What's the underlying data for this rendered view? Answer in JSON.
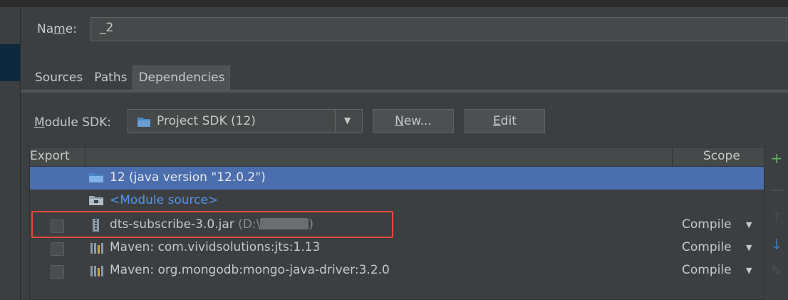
{
  "name_field": {
    "label_prefix": "Na",
    "label_underlined": "m",
    "label_suffix": "e:",
    "value": "_2"
  },
  "tabs": [
    {
      "label": "Sources",
      "active": false
    },
    {
      "label": "Paths",
      "active": false
    },
    {
      "label": "Dependencies",
      "active": true
    }
  ],
  "module_sdk": {
    "label_underlined": "M",
    "label_rest": "odule SDK:",
    "selected": "Project SDK (12)",
    "new_button_underlined": "N",
    "new_button_rest": "ew...",
    "edit_button_underlined": "E",
    "edit_button_rest": "dit"
  },
  "table": {
    "header_export": "Export",
    "header_scope": "Scope",
    "rows": [
      {
        "icon": "jdk-folder-icon",
        "text": "12 (java version \"12.0.2\")",
        "scope": "",
        "selected": true
      },
      {
        "icon": "module-source-folder-icon",
        "text": "<Module source>",
        "scope": "",
        "selected": false
      },
      {
        "icon": "jar-archive-icon",
        "text": "dts-subscribe-3.0.jar",
        "path_prefix": "(D:\\",
        "path_suffix": ")",
        "scope": "Compile",
        "selected": false
      },
      {
        "icon": "maven-library-icon",
        "text": "Maven: com.vividsolutions:jts:1.13",
        "scope": "Compile",
        "selected": false
      },
      {
        "icon": "maven-library-icon",
        "text": "Maven: org.mongodb:mongo-java-driver:3.2.0",
        "scope": "Compile",
        "selected": false
      }
    ]
  },
  "toolbar": {
    "add": "+",
    "remove": "—",
    "move_up": "🡑",
    "move_down": "🡓",
    "edit": "✎"
  },
  "colors": {
    "background": "#3c3f41",
    "selection": "#4b6eaf",
    "link": "#5394ec",
    "highlight_border": "#e8473b",
    "add_icon": "#5ab65a",
    "down_icon": "#3d8edb"
  }
}
